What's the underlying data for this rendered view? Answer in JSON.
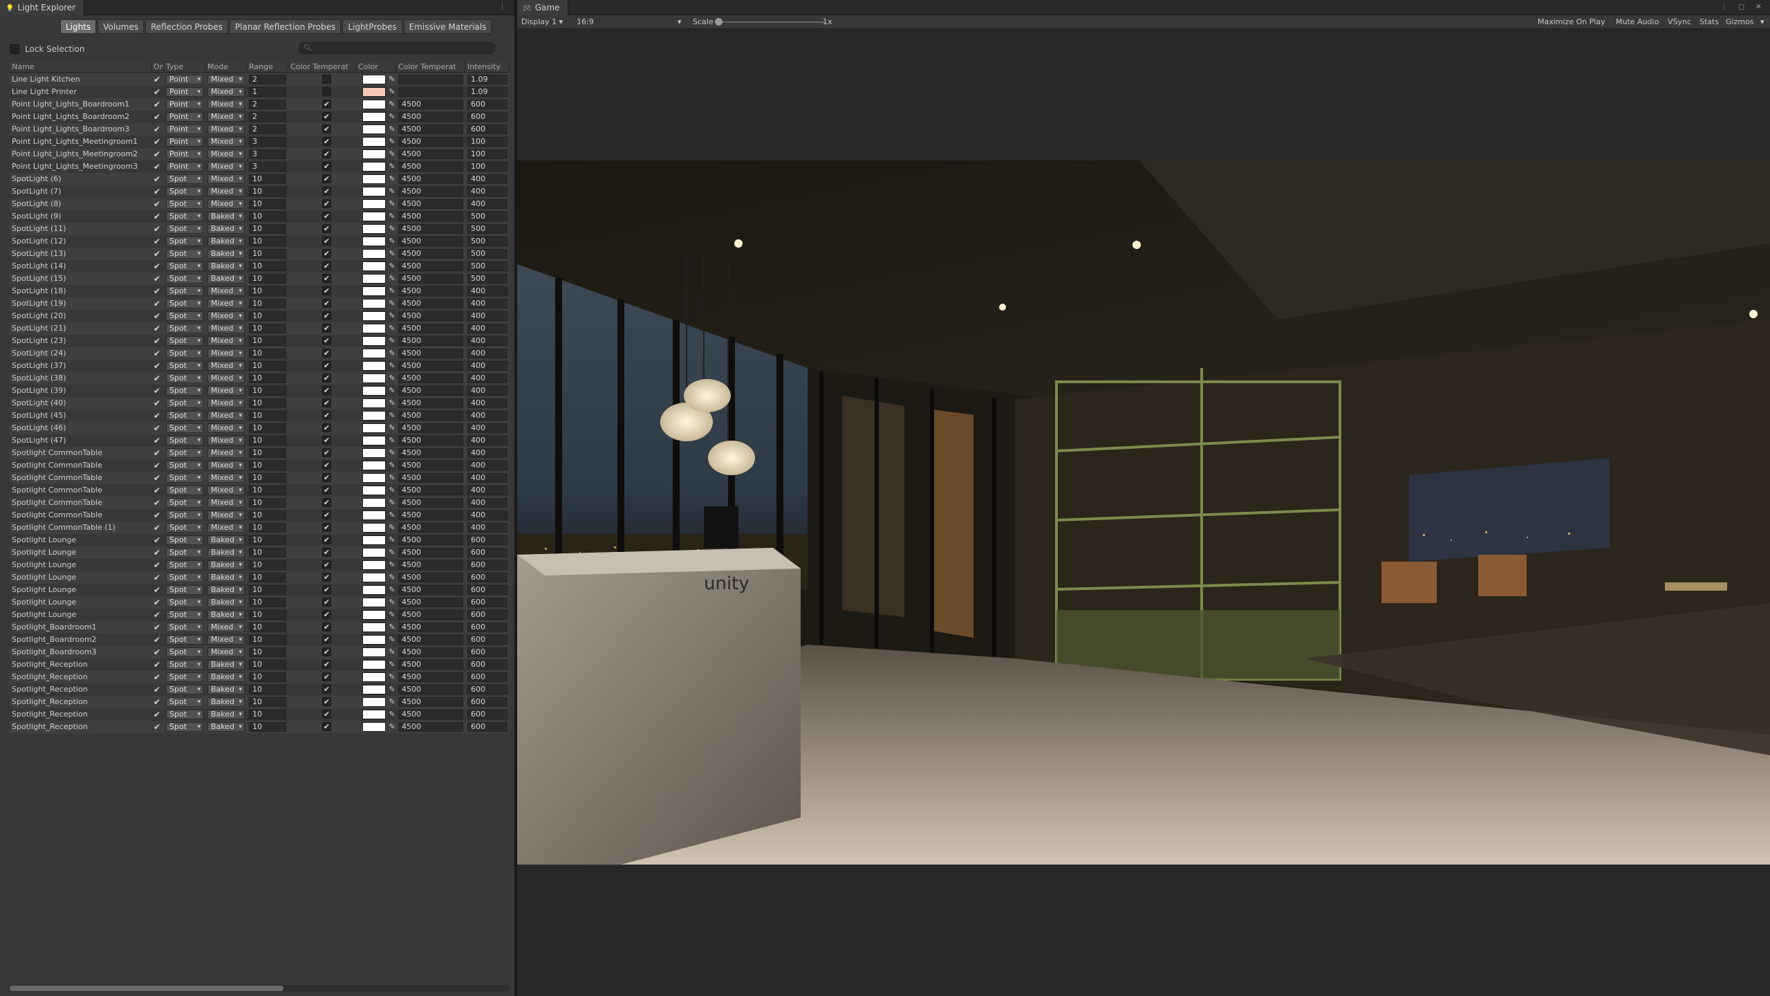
{
  "light_explorer": {
    "title": "Light Explorer",
    "tabs": [
      "Lights",
      "Volumes",
      "Reflection Probes",
      "Planar Reflection Probes",
      "LightProbes",
      "Emissive Materials"
    ],
    "active_tab": "Lights",
    "lock_selection": "Lock Selection",
    "search_placeholder": "",
    "columns": [
      "Name",
      "On",
      "Type",
      "Mode",
      "Range",
      "Color Temperat",
      "Color",
      "Color Temperat",
      "Intensity"
    ],
    "rows": [
      {
        "name": "Line Light Kitchen",
        "type": "Point",
        "mode": "Mixed",
        "range": "2",
        "ct": false,
        "color": "#ffffff",
        "temp": "",
        "intensity": "1.09"
      },
      {
        "name": "Line Light Printer",
        "type": "Point",
        "mode": "Mixed",
        "range": "1",
        "ct": false,
        "color": "#f2c9b4",
        "temp": "",
        "intensity": "1.09"
      },
      {
        "name": "Point Light_Lights_Boardroom1",
        "type": "Point",
        "mode": "Mixed",
        "range": "2",
        "ct": true,
        "color": "#ffffff",
        "temp": "4500",
        "intensity": "600"
      },
      {
        "name": "Point Light_Lights_Boardroom2",
        "type": "Point",
        "mode": "Mixed",
        "range": "2",
        "ct": true,
        "color": "#ffffff",
        "temp": "4500",
        "intensity": "600"
      },
      {
        "name": "Point Light_Lights_Boardroom3",
        "type": "Point",
        "mode": "Mixed",
        "range": "2",
        "ct": true,
        "color": "#ffffff",
        "temp": "4500",
        "intensity": "600"
      },
      {
        "name": "Point Light_Lights_Meetingroom1",
        "type": "Point",
        "mode": "Mixed",
        "range": "3",
        "ct": true,
        "color": "#ffffff",
        "temp": "4500",
        "intensity": "100"
      },
      {
        "name": "Point Light_Lights_Meetingroom2",
        "type": "Point",
        "mode": "Mixed",
        "range": "3",
        "ct": true,
        "color": "#ffffff",
        "temp": "4500",
        "intensity": "100"
      },
      {
        "name": "Point Light_Lights_Meetingroom3",
        "type": "Point",
        "mode": "Mixed",
        "range": "3",
        "ct": true,
        "color": "#ffffff",
        "temp": "4500",
        "intensity": "100"
      },
      {
        "name": "SpotLight (6)",
        "type": "Spot",
        "mode": "Mixed",
        "range": "10",
        "ct": true,
        "color": "#ffffff",
        "temp": "4500",
        "intensity": "400"
      },
      {
        "name": "SpotLight (7)",
        "type": "Spot",
        "mode": "Mixed",
        "range": "10",
        "ct": true,
        "color": "#ffffff",
        "temp": "4500",
        "intensity": "400"
      },
      {
        "name": "SpotLight (8)",
        "type": "Spot",
        "mode": "Mixed",
        "range": "10",
        "ct": true,
        "color": "#ffffff",
        "temp": "4500",
        "intensity": "400"
      },
      {
        "name": "SpotLight (9)",
        "type": "Spot",
        "mode": "Baked",
        "range": "10",
        "ct": true,
        "color": "#ffffff",
        "temp": "4500",
        "intensity": "500"
      },
      {
        "name": "SpotLight (11)",
        "type": "Spot",
        "mode": "Baked",
        "range": "10",
        "ct": true,
        "color": "#ffffff",
        "temp": "4500",
        "intensity": "500"
      },
      {
        "name": "SpotLight (12)",
        "type": "Spot",
        "mode": "Baked",
        "range": "10",
        "ct": true,
        "color": "#ffffff",
        "temp": "4500",
        "intensity": "500"
      },
      {
        "name": "SpotLight (13)",
        "type": "Spot",
        "mode": "Baked",
        "range": "10",
        "ct": true,
        "color": "#ffffff",
        "temp": "4500",
        "intensity": "500"
      },
      {
        "name": "SpotLight (14)",
        "type": "Spot",
        "mode": "Baked",
        "range": "10",
        "ct": true,
        "color": "#ffffff",
        "temp": "4500",
        "intensity": "500"
      },
      {
        "name": "SpotLight (15)",
        "type": "Spot",
        "mode": "Baked",
        "range": "10",
        "ct": true,
        "color": "#ffffff",
        "temp": "4500",
        "intensity": "500"
      },
      {
        "name": "SpotLight (18)",
        "type": "Spot",
        "mode": "Mixed",
        "range": "10",
        "ct": true,
        "color": "#ffffff",
        "temp": "4500",
        "intensity": "400"
      },
      {
        "name": "SpotLight (19)",
        "type": "Spot",
        "mode": "Mixed",
        "range": "10",
        "ct": true,
        "color": "#ffffff",
        "temp": "4500",
        "intensity": "400"
      },
      {
        "name": "SpotLight (20)",
        "type": "Spot",
        "mode": "Mixed",
        "range": "10",
        "ct": true,
        "color": "#ffffff",
        "temp": "4500",
        "intensity": "400"
      },
      {
        "name": "SpotLight (21)",
        "type": "Spot",
        "mode": "Mixed",
        "range": "10",
        "ct": true,
        "color": "#ffffff",
        "temp": "4500",
        "intensity": "400"
      },
      {
        "name": "SpotLight (23)",
        "type": "Spot",
        "mode": "Mixed",
        "range": "10",
        "ct": true,
        "color": "#ffffff",
        "temp": "4500",
        "intensity": "400"
      },
      {
        "name": "SpotLight (24)",
        "type": "Spot",
        "mode": "Mixed",
        "range": "10",
        "ct": true,
        "color": "#ffffff",
        "temp": "4500",
        "intensity": "400"
      },
      {
        "name": "SpotLight (37)",
        "type": "Spot",
        "mode": "Mixed",
        "range": "10",
        "ct": true,
        "color": "#ffffff",
        "temp": "4500",
        "intensity": "400"
      },
      {
        "name": "SpotLight (38)",
        "type": "Spot",
        "mode": "Mixed",
        "range": "10",
        "ct": true,
        "color": "#ffffff",
        "temp": "4500",
        "intensity": "400"
      },
      {
        "name": "SpotLight (39)",
        "type": "Spot",
        "mode": "Mixed",
        "range": "10",
        "ct": true,
        "color": "#ffffff",
        "temp": "4500",
        "intensity": "400"
      },
      {
        "name": "SpotLight (40)",
        "type": "Spot",
        "mode": "Mixed",
        "range": "10",
        "ct": true,
        "color": "#ffffff",
        "temp": "4500",
        "intensity": "400"
      },
      {
        "name": "SpotLight (45)",
        "type": "Spot",
        "mode": "Mixed",
        "range": "10",
        "ct": true,
        "color": "#ffffff",
        "temp": "4500",
        "intensity": "400"
      },
      {
        "name": "SpotLight (46)",
        "type": "Spot",
        "mode": "Mixed",
        "range": "10",
        "ct": true,
        "color": "#ffffff",
        "temp": "4500",
        "intensity": "400"
      },
      {
        "name": "SpotLight (47)",
        "type": "Spot",
        "mode": "Mixed",
        "range": "10",
        "ct": true,
        "color": "#ffffff",
        "temp": "4500",
        "intensity": "400"
      },
      {
        "name": "Spotlight CommonTable",
        "type": "Spot",
        "mode": "Mixed",
        "range": "10",
        "ct": true,
        "color": "#ffffff",
        "temp": "4500",
        "intensity": "400"
      },
      {
        "name": "Spotlight CommonTable",
        "type": "Spot",
        "mode": "Mixed",
        "range": "10",
        "ct": true,
        "color": "#ffffff",
        "temp": "4500",
        "intensity": "400"
      },
      {
        "name": "Spotlight CommonTable",
        "type": "Spot",
        "mode": "Mixed",
        "range": "10",
        "ct": true,
        "color": "#ffffff",
        "temp": "4500",
        "intensity": "400"
      },
      {
        "name": "Spotlight CommonTable",
        "type": "Spot",
        "mode": "Mixed",
        "range": "10",
        "ct": true,
        "color": "#ffffff",
        "temp": "4500",
        "intensity": "400"
      },
      {
        "name": "Spotlight CommonTable",
        "type": "Spot",
        "mode": "Mixed",
        "range": "10",
        "ct": true,
        "color": "#ffffff",
        "temp": "4500",
        "intensity": "400"
      },
      {
        "name": "Spotlight CommonTable",
        "type": "Spot",
        "mode": "Mixed",
        "range": "10",
        "ct": true,
        "color": "#ffffff",
        "temp": "4500",
        "intensity": "400"
      },
      {
        "name": "Spotlight CommonTable (1)",
        "type": "Spot",
        "mode": "Mixed",
        "range": "10",
        "ct": true,
        "color": "#ffffff",
        "temp": "4500",
        "intensity": "400"
      },
      {
        "name": "Spotlight Lounge",
        "type": "Spot",
        "mode": "Baked",
        "range": "10",
        "ct": true,
        "color": "#ffffff",
        "temp": "4500",
        "intensity": "600"
      },
      {
        "name": "Spotlight Lounge",
        "type": "Spot",
        "mode": "Baked",
        "range": "10",
        "ct": true,
        "color": "#ffffff",
        "temp": "4500",
        "intensity": "600"
      },
      {
        "name": "Spotlight Lounge",
        "type": "Spot",
        "mode": "Baked",
        "range": "10",
        "ct": true,
        "color": "#ffffff",
        "temp": "4500",
        "intensity": "600"
      },
      {
        "name": "Spotlight Lounge",
        "type": "Spot",
        "mode": "Baked",
        "range": "10",
        "ct": true,
        "color": "#ffffff",
        "temp": "4500",
        "intensity": "600"
      },
      {
        "name": "Spotlight Lounge",
        "type": "Spot",
        "mode": "Baked",
        "range": "10",
        "ct": true,
        "color": "#ffffff",
        "temp": "4500",
        "intensity": "600"
      },
      {
        "name": "Spotlight Lounge",
        "type": "Spot",
        "mode": "Baked",
        "range": "10",
        "ct": true,
        "color": "#ffffff",
        "temp": "4500",
        "intensity": "600"
      },
      {
        "name": "Spotlight Lounge",
        "type": "Spot",
        "mode": "Baked",
        "range": "10",
        "ct": true,
        "color": "#ffffff",
        "temp": "4500",
        "intensity": "600"
      },
      {
        "name": "Spotlight_Boardroom1",
        "type": "Spot",
        "mode": "Mixed",
        "range": "10",
        "ct": true,
        "color": "#ffffff",
        "temp": "4500",
        "intensity": "600"
      },
      {
        "name": "Spotlight_Boardroom2",
        "type": "Spot",
        "mode": "Mixed",
        "range": "10",
        "ct": true,
        "color": "#ffffff",
        "temp": "4500",
        "intensity": "600"
      },
      {
        "name": "Spotlight_Boardroom3",
        "type": "Spot",
        "mode": "Mixed",
        "range": "10",
        "ct": true,
        "color": "#ffffff",
        "temp": "4500",
        "intensity": "600"
      },
      {
        "name": "Spotlight_Reception",
        "type": "Spot",
        "mode": "Baked",
        "range": "10",
        "ct": true,
        "color": "#ffffff",
        "temp": "4500",
        "intensity": "600"
      },
      {
        "name": "Spotlight_Reception",
        "type": "Spot",
        "mode": "Baked",
        "range": "10",
        "ct": true,
        "color": "#ffffff",
        "temp": "4500",
        "intensity": "600"
      },
      {
        "name": "Spotlight_Reception",
        "type": "Spot",
        "mode": "Baked",
        "range": "10",
        "ct": true,
        "color": "#ffffff",
        "temp": "4500",
        "intensity": "600"
      },
      {
        "name": "Spotlight_Reception",
        "type": "Spot",
        "mode": "Baked",
        "range": "10",
        "ct": true,
        "color": "#ffffff",
        "temp": "4500",
        "intensity": "600"
      },
      {
        "name": "Spotlight_Reception",
        "type": "Spot",
        "mode": "Baked",
        "range": "10",
        "ct": true,
        "color": "#ffffff",
        "temp": "4500",
        "intensity": "600"
      },
      {
        "name": "Spotlight_Reception",
        "type": "Spot",
        "mode": "Baked",
        "range": "10",
        "ct": true,
        "color": "#ffffff",
        "temp": "4500",
        "intensity": "600"
      }
    ]
  },
  "game": {
    "title": "Game",
    "display": "Display 1",
    "aspect": "16:9",
    "scale_label": "Scale",
    "scale_value": "1x",
    "toolbar_buttons": [
      "Maximize On Play",
      "Mute Audio",
      "VSync",
      "Stats",
      "Gizmos"
    ],
    "scene_logo_text": "unity"
  }
}
